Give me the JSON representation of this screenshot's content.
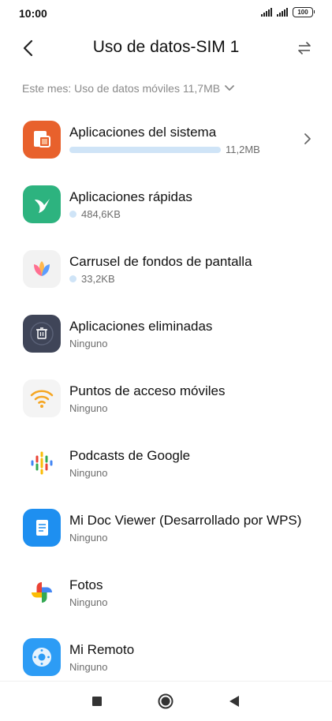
{
  "status_bar": {
    "time": "10:00",
    "battery": "100"
  },
  "header": {
    "title": "Uso de datos-SIM 1"
  },
  "month_selector": {
    "label": "Este mes: Uso de datos móviles 11,7MB"
  },
  "apps": [
    {
      "name": "Aplicaciones del sistema",
      "usage": "11,2MB",
      "bar_fraction": 1.0,
      "icon": "system-apps-icon",
      "color": "#e8612c"
    },
    {
      "name": "Aplicaciones rápidas",
      "usage": "484,6KB",
      "icon": "quick-apps-hummingbird-icon",
      "color": "#2db37f"
    },
    {
      "name": "Carrusel de fondos de pantalla",
      "usage": "33,2KB",
      "icon": "wallpaper-carousel-icon",
      "color": "#f2f2f2"
    },
    {
      "name": "Aplicaciones eliminadas",
      "usage": "Ninguno",
      "icon": "trash-icon",
      "color": "#3f4558"
    },
    {
      "name": "Puntos de acceso móviles",
      "usage": "Ninguno",
      "icon": "wifi-hotspot-icon",
      "color": "#f4f4f4"
    },
    {
      "name": "Podcasts de Google",
      "usage": "Ninguno",
      "icon": "google-podcasts-icon",
      "color": "#ffffff"
    },
    {
      "name": "Mi Doc Viewer (Desarrollado por WPS)",
      "usage": "Ninguno",
      "icon": "document-icon",
      "color": "#1e8ff0"
    },
    {
      "name": "Fotos",
      "usage": "Ninguno",
      "icon": "google-photos-pinwheel-icon",
      "color": "#ffffff"
    },
    {
      "name": "Mi Remoto",
      "usage": "Ninguno",
      "icon": "remote-control-icon",
      "color": "#2d9cf5"
    }
  ],
  "colors": {
    "usage_bar": "#cfe4f7",
    "secondary_text": "#6d6d6d"
  }
}
